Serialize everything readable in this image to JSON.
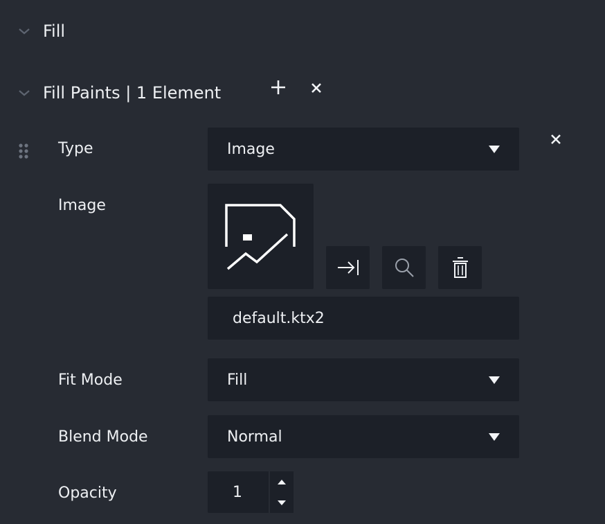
{
  "fill_section": {
    "title": "Fill",
    "chevron_icon": "chevron-down-icon"
  },
  "fill_paints": {
    "title": "Fill Paints | 1 Element",
    "add_icon": "plus-icon",
    "clear_icon": "close-icon",
    "entry": {
      "drag_handle_icon": "drag-handle-icon",
      "remove_icon": "close-icon",
      "type": {
        "label": "Type",
        "value": "Image"
      },
      "image": {
        "label": "Image",
        "thumbnail_icon": "image-placeholder-icon",
        "buttons": {
          "assign_icon": "arrow-right-to-line-icon",
          "locate_icon": "search-icon",
          "delete_icon": "trash-icon"
        },
        "file_name": "default.ktx2"
      },
      "fit_mode": {
        "label": "Fit Mode",
        "value": "Fill"
      },
      "blend_mode": {
        "label": "Blend Mode",
        "value": "Normal"
      },
      "opacity": {
        "label": "Opacity",
        "value": "1"
      }
    }
  },
  "colors": {
    "panel_bg": "#272b33",
    "field_bg": "#1c2028",
    "text": "#eef0f3",
    "muted_icon": "#5d6470"
  }
}
